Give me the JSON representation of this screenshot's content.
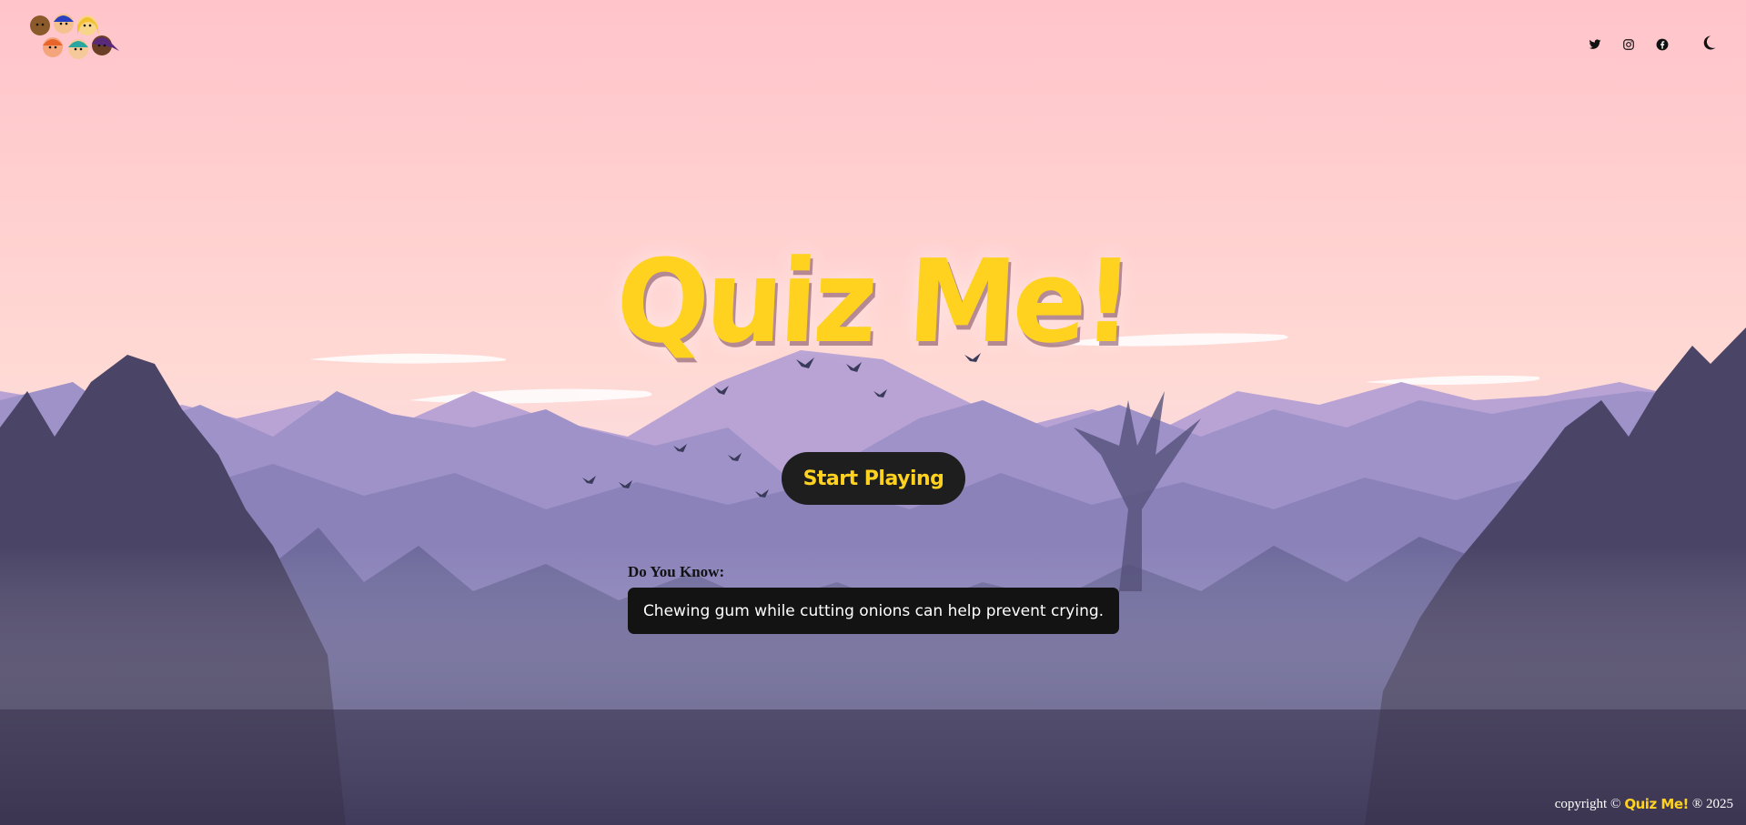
{
  "colors": {
    "sky_top": "#FFC5CB",
    "sky_bottom": "#FDE0D8",
    "accent_yellow": "#FFD21F",
    "button_bg": "#1E1E1E",
    "fact_bg": "#131313",
    "mountain_far": "#C7A9D6",
    "forest_dark": "#3F3C5C"
  },
  "header": {
    "logo_icon": "kids-faces-logo",
    "socials": [
      {
        "name": "twitter",
        "icon": "twitter-icon"
      },
      {
        "name": "instagram",
        "icon": "instagram-icon"
      },
      {
        "name": "facebook",
        "icon": "facebook-icon"
      }
    ],
    "theme_toggle_icon": "moon-icon"
  },
  "hero": {
    "title": "Quiz Me!",
    "start_button": "Start Playing"
  },
  "fact": {
    "label": "Do You Know:",
    "text": "Chewing gum while cutting onions can help prevent crying."
  },
  "footer": {
    "prefix": "copyright ©",
    "brand": "Quiz Me!",
    "suffix": "® 2025"
  }
}
